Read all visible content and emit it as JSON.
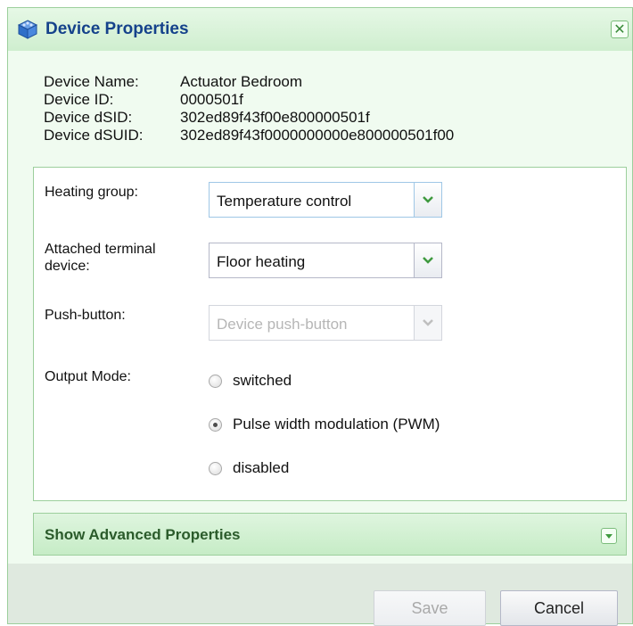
{
  "dialog": {
    "title": "Device Properties",
    "close_glyph": "✕",
    "title_icon": "device-cube-icon",
    "accent_color": "#15428b"
  },
  "info": {
    "rows": [
      {
        "label": "Device Name:",
        "value": "Actuator Bedroom"
      },
      {
        "label": "Device ID:",
        "value": "0000501f"
      },
      {
        "label": "Device dSID:",
        "value": "302ed89f43f00e800000501f"
      },
      {
        "label": "Device dSUID:",
        "value": "302ed89f43f0000000000e800000501f00"
      }
    ]
  },
  "form": {
    "heating_group": {
      "label": "Heating group:",
      "value": "Temperature control"
    },
    "terminal_device": {
      "label_line1": "Attached terminal",
      "label_line2": "device:",
      "value": "Floor heating"
    },
    "push_button": {
      "label": "Push-button:",
      "value": "Device push-button",
      "disabled": true
    },
    "output_mode": {
      "label": "Output Mode:",
      "options": [
        {
          "label": "switched",
          "checked": false
        },
        {
          "label": "Pulse width modulation (PWM)",
          "checked": true
        },
        {
          "label": "disabled",
          "checked": false
        }
      ]
    }
  },
  "advanced": {
    "title": "Show Advanced Properties",
    "toggle_icon": "chevron-down-icon"
  },
  "footer": {
    "save_label": "Save",
    "cancel_label": "Cancel"
  }
}
